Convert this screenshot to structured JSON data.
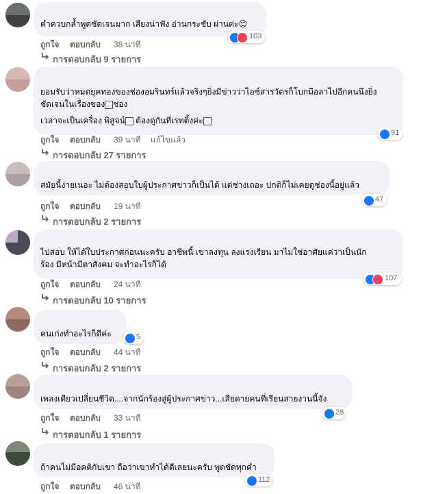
{
  "reaction_colors": {
    "like": "#1877f2",
    "love": "#f33e58"
  },
  "comments": [
    {
      "lines": [
        "คำควบกล้ำพูดชัดเจนมาก เสียงน่าฟัง อ่านกระชับ ผ่านค่ะ😊"
      ],
      "like_label": "ถูกใจ",
      "reply_label": "ตอบกลับ",
      "time": "38 นาที",
      "edited": "",
      "replies": "การตอบกลับ 9 รายการ",
      "reaction_count": "103",
      "reactions": [
        "like",
        "love"
      ]
    },
    {
      "lines": [
        "ยอมรับว่าหมดยุคทองของช่องอมรินทร์แล้วจริงๆยิ่งมีข่าวว่าไอซ์สารวัตรก็โบกมือลาไปอีกคนนึงยิ่ง",
        "ชัดเจนในเรื่องของ",
        "ช่อง",
        "เวลาจะเป็นเครื่อง พิสูจน์",
        "ต้องดูกันที่เรทติ้งค่ะ"
      ],
      "like_label": "ถูกใจ",
      "reply_label": "ตอบกลับ",
      "time": "39 นาที",
      "edited": "แก้ไขแล้ว",
      "replies": "การตอบกลับ 27 รายการ",
      "reaction_count": "91",
      "reactions": [
        "like"
      ]
    },
    {
      "lines": [
        "สมัยนี้ง่ายเนอะ ไม่ต้องสอบใบผู้ประกาศข่าวก็เป็นได้ แต่ช่างเถอะ ปกติก็ไม่เคยดูช่องนี้อยู่แล้ว"
      ],
      "like_label": "ถูกใจ",
      "reply_label": "ตอบกลับ",
      "time": "19 นาที",
      "edited": "",
      "replies": "การตอบกลับ 2 รายการ",
      "reaction_count": "47",
      "reactions": [
        "like"
      ]
    },
    {
      "lines": [
        "ไปสอบ ให้ได้ใบประกาศก่อนนะครับ อาชีพนี้ เขาลงทุน ลงแรงเรียน มาไม่ใช่อาศัยแค่ว่าเป็นนัก",
        "ร้อง มีหน้ามีตาสังคม จะทำอะไรก็ได้"
      ],
      "like_label": "ถูกใจ",
      "reply_label": "ตอบกลับ",
      "time": "24 นาที",
      "edited": "",
      "replies": "การตอบกลับ 10 รายการ",
      "reaction_count": "107",
      "reactions": [
        "like",
        "love"
      ]
    },
    {
      "lines": [
        "คนเก่งทำอะไรก็ดีค่ะ"
      ],
      "like_label": "ถูกใจ",
      "reply_label": "ตอบกลับ",
      "time": "44 นาที",
      "edited": "",
      "replies": "การตอบกลับ 2 รายการ",
      "reaction_count": "5",
      "reactions": [
        "like"
      ]
    },
    {
      "lines": [
        "เพลงเดียวเปลี่ยนชีวิต....จากนักร้องสู่ผู้ประกาศข่าว...เสียดายคนที่เรียนสายงานนี้จัง"
      ],
      "like_label": "ถูกใจ",
      "reply_label": "ตอบกลับ",
      "time": "33 นาที",
      "edited": "",
      "replies": "การตอบกลับ 1 รายการ",
      "reaction_count": "28",
      "reactions": [
        "like"
      ]
    },
    {
      "lines": [
        "ถ้าคนไม่มีอคติกับเขา ถือว่าเขาทำได้ดีเลยนะครับ พูดชัดทุกคำ"
      ],
      "like_label": "ถูกใจ",
      "reply_label": "ตอบกลับ",
      "time": "46 นาที",
      "edited": "",
      "replies": "",
      "reaction_count": "112",
      "reactions": [
        "like"
      ]
    }
  ]
}
